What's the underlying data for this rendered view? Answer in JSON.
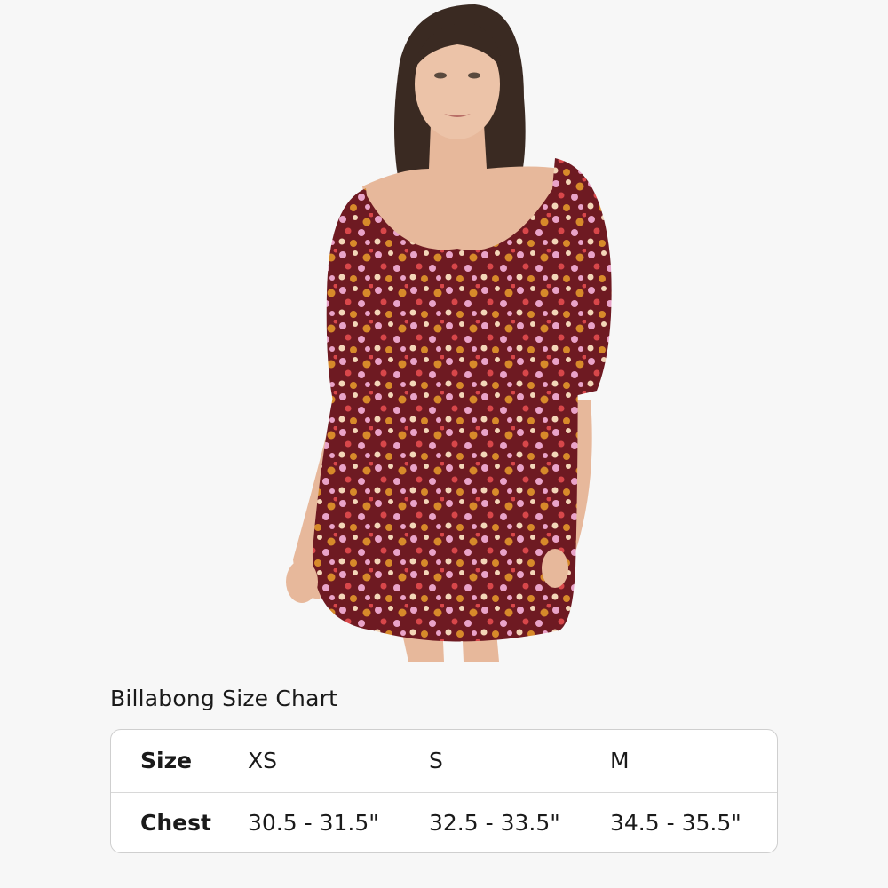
{
  "size_chart": {
    "title": "Billabong Size Chart",
    "rows": [
      {
        "header": "Size",
        "values": [
          "XS",
          "S",
          "M"
        ]
      },
      {
        "header": "Chest",
        "values": [
          "30.5 - 31.5\"",
          "32.5 - 33.5\"",
          "34.5 - 35.5\""
        ]
      }
    ]
  },
  "colors": {
    "background": "#f7f7f7",
    "dress_base": "#6e1a22",
    "flower_pink": "#e9a3c8",
    "flower_orange": "#d78a2a",
    "flower_cream": "#f3d6b8",
    "flower_red": "#d8474a"
  }
}
